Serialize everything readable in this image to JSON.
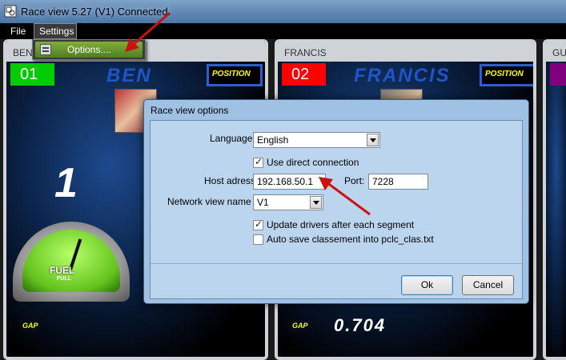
{
  "window": {
    "title": "Race view 5.27 (V1) Connected."
  },
  "menubar": {
    "file": "File",
    "settings": "Settings"
  },
  "settings_menu": {
    "options": "Options...."
  },
  "panels": {
    "ben": {
      "header": "BEN",
      "number": "01",
      "name": "BEN",
      "position_label": "POSITION",
      "position": "1",
      "fuel_label": "FUEL",
      "fuel_sub": "FULL",
      "gap_label": "GAP"
    },
    "francis": {
      "header": "FRANCIS",
      "number": "02",
      "name": "FRANCIS",
      "position_label": "POSITION",
      "gap_label": "GAP",
      "gap_value": "0.704"
    },
    "third": {
      "header": "GUT"
    }
  },
  "dialog": {
    "title": "Race view options",
    "language_label": "Language:",
    "language_value": "English",
    "use_direct_connection": "Use direct connection",
    "host_label": "Host adress:",
    "host_value": "192.168.50.1",
    "port_label": "Port:",
    "port_value": "7228",
    "network_view_label": "Network view name :",
    "network_view_value": "V1",
    "update_drivers": "Update drivers after each segment",
    "auto_save": "Auto save classement into pclc_clas.txt",
    "ok": "Ok",
    "cancel": "Cancel"
  },
  "colors": {
    "ben_number": "#00cc00",
    "francis_number": "#ff0000",
    "third_number": "#800080",
    "name_blue": "#1e56c9",
    "annotation_arrow": "#cc1111"
  }
}
